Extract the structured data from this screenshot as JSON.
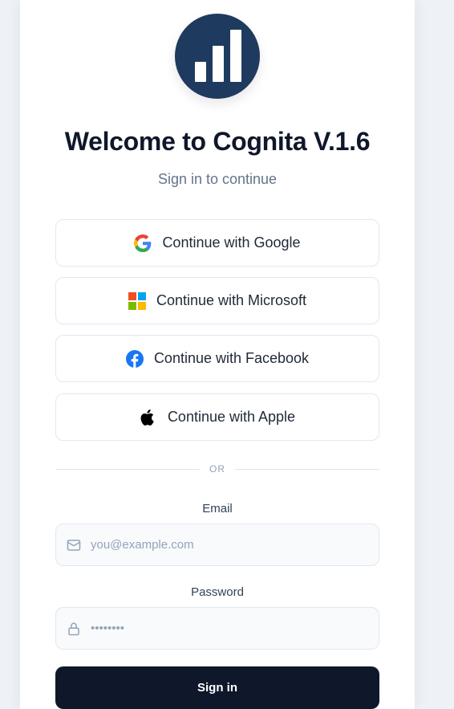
{
  "brand": {
    "logo_color": "#1e3a5f",
    "title": "Welcome to Cognita V.1.6",
    "subtitle": "Sign in to continue"
  },
  "oauth": [
    {
      "label": "Continue with Google",
      "icon": "google-icon"
    },
    {
      "label": "Continue with Microsoft",
      "icon": "microsoft-icon"
    },
    {
      "label": "Continue with Facebook",
      "icon": "facebook-icon"
    },
    {
      "label": "Continue with Apple",
      "icon": "apple-icon"
    }
  ],
  "divider": {
    "text": "OR"
  },
  "email": {
    "label": "Email",
    "placeholder": "you@example.com",
    "icon": "mail-icon"
  },
  "password": {
    "label": "Password",
    "value": "••••••••",
    "icon": "lock-icon"
  },
  "submit": {
    "label": "Sign in",
    "color": "#0f172a"
  }
}
